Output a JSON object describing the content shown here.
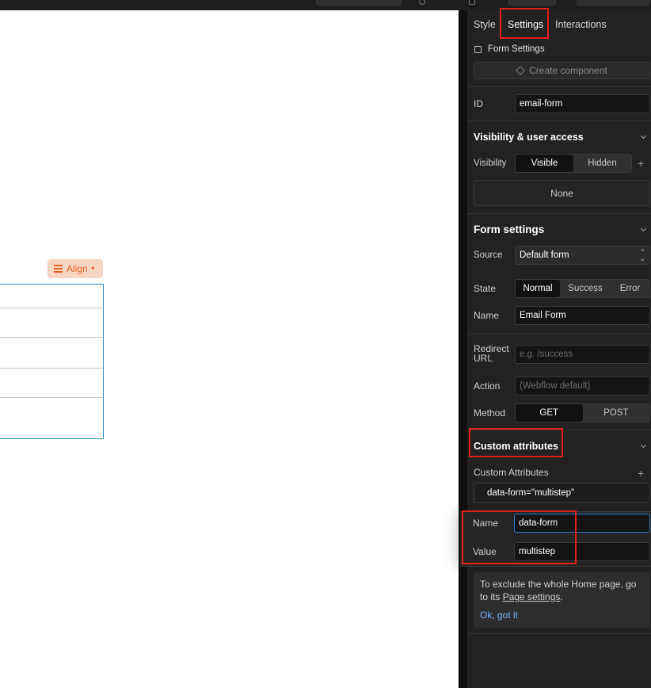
{
  "tabs": {
    "style": "Style",
    "settings": "Settings",
    "interactions": "Interactions"
  },
  "element": {
    "checkbox_label": "Form Settings",
    "create_component": "Create component"
  },
  "id_field": {
    "label": "ID",
    "value": "email-form"
  },
  "visibility_section": {
    "heading": "Visibility & user access",
    "label": "Visibility",
    "options": [
      "Visible",
      "Hidden"
    ],
    "selected": "Visible",
    "access_value": "None"
  },
  "form_settings": {
    "heading": "Form settings",
    "source": {
      "label": "Source",
      "value": "Default form"
    },
    "state": {
      "label": "State",
      "options": [
        "Normal",
        "Success",
        "Error"
      ],
      "selected": "Normal"
    },
    "name": {
      "label": "Name",
      "value": "Email Form"
    },
    "redirect": {
      "label": "Redirect URL",
      "placeholder": "e.g. /success"
    },
    "action": {
      "label": "Action",
      "placeholder": "(Webflow default)"
    },
    "method": {
      "label": "Method",
      "options": [
        "GET",
        "POST"
      ],
      "selected": "GET"
    }
  },
  "custom_attributes": {
    "heading": "Custom attributes",
    "subheading": "Custom Attributes",
    "items": [
      "data-form=\"multistep\""
    ],
    "edit": {
      "name_label": "Name",
      "name_value": "data-form",
      "value_label": "Value",
      "value_value": "multistep"
    }
  },
  "callout": {
    "text_before": "To exclude the whole Home page, go to its ",
    "link": "Page settings",
    "text_after": ".",
    "action": "Ok, got it"
  },
  "canvas": {
    "align_label": "Align"
  },
  "colors": {
    "accent": "#e85f1e",
    "highlight": "#e0201b",
    "selection": "#2a8fd6",
    "panel": "#222222"
  }
}
